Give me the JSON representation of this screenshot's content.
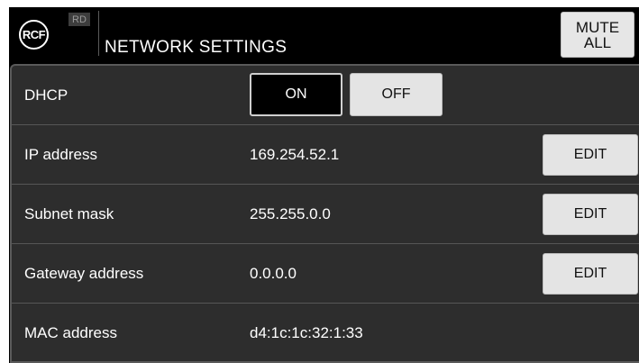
{
  "header": {
    "logo_text": "RCF",
    "badge": "RD",
    "title": "NETWORK SETTINGS",
    "mute_line1": "MUTE",
    "mute_line2": "ALL"
  },
  "rows": [
    {
      "label": "DHCP",
      "on_label": "ON",
      "off_label": "OFF",
      "selected": "ON"
    },
    {
      "label": "IP address",
      "value": "169.254.52.1",
      "button": "EDIT"
    },
    {
      "label": "Subnet mask",
      "value": "255.255.0.0",
      "button": "EDIT"
    },
    {
      "label": "Gateway address",
      "value": "0.0.0.0",
      "button": "EDIT"
    },
    {
      "label": "MAC address",
      "value": "d4:1c:1c:32:1:33"
    }
  ]
}
